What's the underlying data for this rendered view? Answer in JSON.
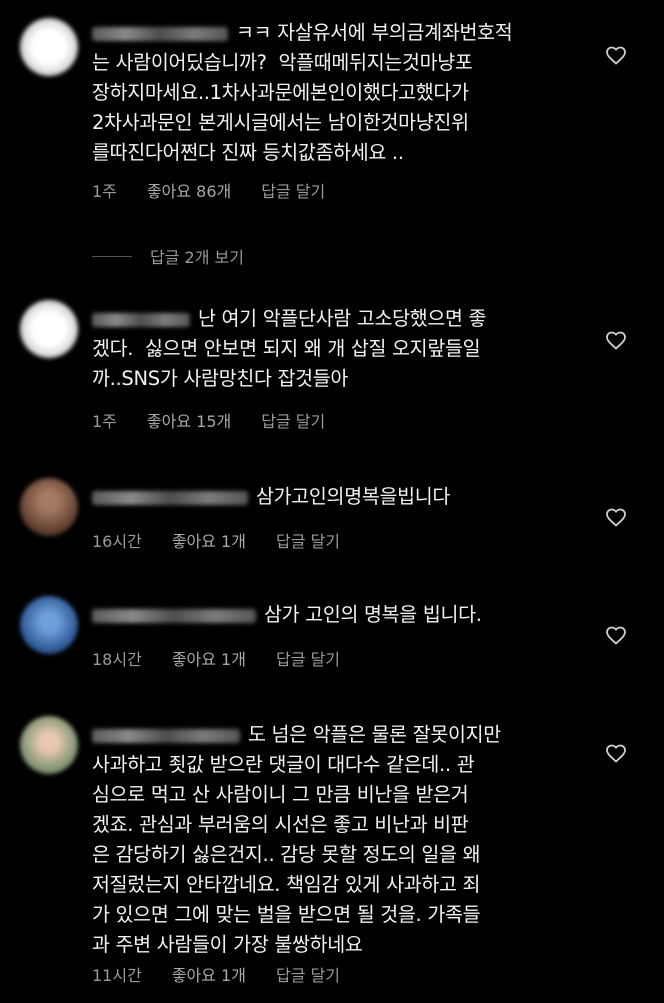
{
  "comments": [
    {
      "text": "ㅋㅋ 자살유서에 부의금계좌번호적\n는 사람이어딨습니까?  악플때메뒤지는것마냥포\n장하지마세요..1차사과문에본인이했다고했다가\n2차사과문인 본게시글에서는 남이한것마냥진위\n를따진다어쩐다 진짜 등치값좀하세요 ..",
      "time": "1주",
      "likes": "좋아요 86개",
      "reply": "답글 달기",
      "avatar_color": "#e6e6e6"
    },
    {
      "text": "난 여기 악플단사람 고소당했으면 좋\n겠다.  싫으면 안보면 되지 왜 개 삽질 오지랖들일\n까..SNS가 사람망친다 잡것들아",
      "time": "1주",
      "likes": "좋아요 15개",
      "reply": "답글 달기",
      "avatar_color": "#e6e6e6"
    },
    {
      "text": "삼가고인의명복을빕니다",
      "time": "16시간",
      "likes": "좋아요 1개",
      "reply": "답글 달기",
      "avatar_color": "#6b4a3a"
    },
    {
      "text": "삼가 고인의 명복을 빕니다.",
      "time": "18시간",
      "likes": "좋아요 1개",
      "reply": "답글 달기",
      "avatar_color": "#3d6aa8"
    },
    {
      "text": "도 넘은 악플은 물론 잘못이지만\n사과하고 죗값 받으란 댓글이 대다수 같은데.. 관\n심으로 먹고 산 사람이니 그 만큼 비난을 받은거\n겠죠. 관심과 부러움의 시선은 좋고 비난과 비판\n은 감당하기 싫은건지.. 감당 못할 정도의 일을 왜\n저질렀는지 안타깝네요. 책임감 있게 사과하고 죄\n가 있으면 그에 맞는 벌을 받으면 될 것을. 가족들\n과 주변 사람들이 가장 불쌍하네요",
      "time": "11시간",
      "likes": "좋아요 1개",
      "reply": "답글 달기",
      "avatar_color": "#8a9a7a"
    }
  ],
  "view_replies": "답글 2개 보기"
}
